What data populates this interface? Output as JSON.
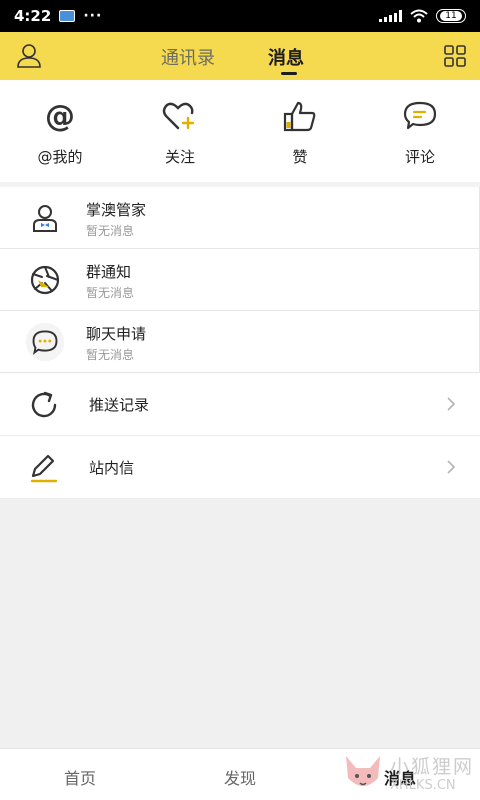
{
  "status_bar": {
    "time": "4:22",
    "dots": "···",
    "battery": "11"
  },
  "header": {
    "tabs": [
      {
        "label": "通讯录",
        "active": false
      },
      {
        "label": "消息",
        "active": true
      }
    ],
    "left_icon": "user-icon",
    "right_icon": "grid-icon",
    "accent": "#f5d94e"
  },
  "quick_actions": [
    {
      "label": "@我的",
      "icon": "at-icon"
    },
    {
      "label": "关注",
      "icon": "heart-plus-icon"
    },
    {
      "label": "赞",
      "icon": "thumbs-up-icon"
    },
    {
      "label": "评论",
      "icon": "comment-icon"
    }
  ],
  "messages": [
    {
      "title": "掌澳管家",
      "subtitle": "暂无消息",
      "icon": "butler-icon"
    },
    {
      "title": "群通知",
      "subtitle": "暂无消息",
      "icon": "shutter-icon"
    },
    {
      "title": "聊天申请",
      "subtitle": "暂无消息",
      "icon": "chat-bubble-icon"
    }
  ],
  "links": [
    {
      "title": "推送记录",
      "icon": "refresh-icon"
    },
    {
      "title": "站内信",
      "icon": "pencil-icon"
    }
  ],
  "bottom_nav": [
    {
      "label": "首页",
      "active": false
    },
    {
      "label": "发现",
      "active": false
    },
    {
      "label": "消息",
      "active": true
    }
  ],
  "watermark": {
    "cn": "小狐狸网",
    "en": "XHLKS.CN"
  }
}
